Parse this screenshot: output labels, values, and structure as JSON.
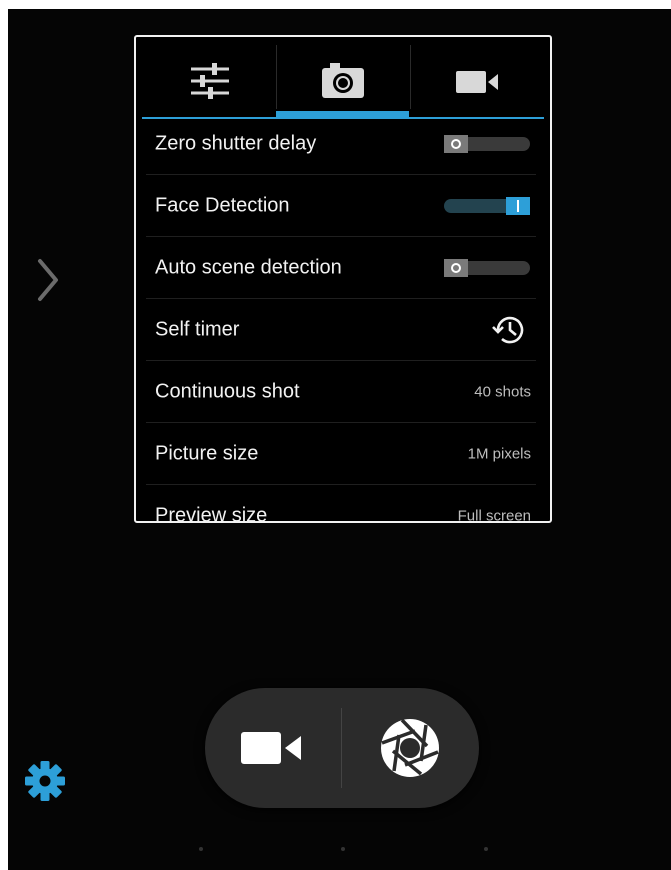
{
  "panel": {
    "tabs": [
      {
        "name": "settings-sliders",
        "icon": "sliders-icon",
        "active": false
      },
      {
        "name": "camera",
        "icon": "camera-icon",
        "active": true
      },
      {
        "name": "video",
        "icon": "video-camera-icon",
        "active": false
      }
    ],
    "rows": [
      {
        "label": "Zero shutter delay",
        "control": "toggle",
        "state": "off"
      },
      {
        "label": "Face Detection",
        "control": "toggle",
        "state": "on"
      },
      {
        "label": "Auto scene detection",
        "control": "toggle",
        "state": "off"
      },
      {
        "label": "Self timer",
        "control": "icon",
        "icon": "timer-icon"
      },
      {
        "label": "Continuous shot",
        "control": "value",
        "value": "40 shots"
      },
      {
        "label": "Picture size",
        "control": "value",
        "value": "1M pixels"
      },
      {
        "label": "Preview size",
        "control": "value",
        "value": "Full screen"
      }
    ]
  },
  "controls": {
    "expand_icon": "chevron-right-icon",
    "video_icon": "video-camera-icon",
    "shutter_icon": "shutter-aperture-icon",
    "settings_icon": "gear-icon"
  },
  "colors": {
    "accent": "#2d9fd8",
    "background": "#050505",
    "panel_border": "#f2f2f2",
    "text": "#f2f2f2"
  }
}
